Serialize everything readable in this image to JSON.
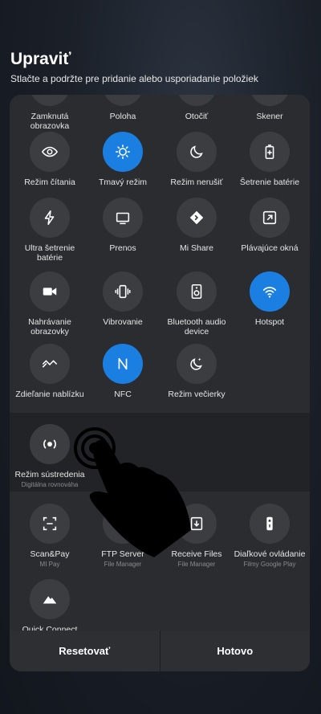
{
  "header": {
    "title": "Upraviť",
    "subtitle": "Stlačte a podržte pre pridanie alebo usporiadanie položiek"
  },
  "active_tiles": [
    {
      "label": "Zamknutá obrazovka",
      "icon": "lock-icon"
    },
    {
      "label": "Poloha",
      "icon": "location-icon"
    },
    {
      "label": "Otočiť",
      "icon": "rotate-icon"
    },
    {
      "label": "Skener",
      "icon": "scanner-icon"
    },
    {
      "label": "Režim čítania",
      "icon": "eye-icon"
    },
    {
      "label": "Tmavý režim",
      "icon": "dark-mode-icon",
      "on": true
    },
    {
      "label": "Režim nerušiť",
      "icon": "moon-icon"
    },
    {
      "label": "Šetrenie batérie",
      "icon": "battery-icon"
    },
    {
      "label": "Ultra šetrenie batérie",
      "icon": "bolt-icon"
    },
    {
      "label": "Prenos",
      "icon": "cast-icon"
    },
    {
      "label": "Mi Share",
      "icon": "mi-share-icon"
    },
    {
      "label": "Plávajúce okná",
      "icon": "floating-window-icon"
    },
    {
      "label": "Nahrávanie obrazovky",
      "icon": "video-icon"
    },
    {
      "label": "Vibrovanie",
      "icon": "vibrate-icon"
    },
    {
      "label": "Bluetooth audio device",
      "icon": "speaker-icon"
    },
    {
      "label": "Hotspot",
      "icon": "hotspot-icon",
      "on": true
    },
    {
      "label": "Zdieľanie nablízku",
      "icon": "nearby-share-icon"
    },
    {
      "label": "NFC",
      "icon": "nfc-icon",
      "on": true
    },
    {
      "label": "Režim večierky",
      "icon": "bedtime-icon"
    }
  ],
  "focus_tile": {
    "label": "Režim sústredenia",
    "sub": "Digitálna rovnováha",
    "icon": "focus-icon"
  },
  "extra_tiles": [
    {
      "label": "Scan&Pay",
      "sub": "MI Pay",
      "icon": "scan-pay-icon"
    },
    {
      "label": "FTP Server",
      "sub": "File Manager",
      "icon": "ftp-icon"
    },
    {
      "label": "Receive Files",
      "sub": "File Manager",
      "icon": "receive-files-icon"
    },
    {
      "label": "Diaľkové ovládanie",
      "sub": "Filmy Google Play",
      "icon": "remote-icon"
    },
    {
      "label": "Quick Connect",
      "sub": "",
      "icon": "mountain-icon"
    }
  ],
  "footer": {
    "reset": "Resetovať",
    "done": "Hotovo"
  },
  "colors": {
    "accent": "#1a7fe0",
    "tile": "#3c3d41",
    "panel": "#2b2c2f"
  }
}
